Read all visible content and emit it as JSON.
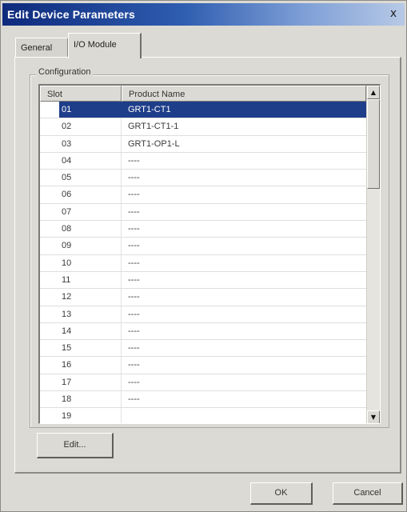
{
  "dialog": {
    "title": "Edit Device Parameters",
    "close_label": "x"
  },
  "tabs": [
    {
      "label": "General",
      "active": false
    },
    {
      "label": "I/O Module",
      "active": true
    }
  ],
  "configuration": {
    "group_label": "Configuration",
    "columns": [
      "Slot",
      "Product Name"
    ],
    "rows": [
      {
        "slot": "01",
        "product": "GRT1-CT1",
        "selected": true
      },
      {
        "slot": "02",
        "product": "GRT1-CT1-1"
      },
      {
        "slot": "03",
        "product": "GRT1-OP1-L"
      },
      {
        "slot": "04",
        "product": "----"
      },
      {
        "slot": "05",
        "product": "----"
      },
      {
        "slot": "06",
        "product": "----"
      },
      {
        "slot": "07",
        "product": "----"
      },
      {
        "slot": "08",
        "product": "----"
      },
      {
        "slot": "09",
        "product": "----"
      },
      {
        "slot": "10",
        "product": "----"
      },
      {
        "slot": "11",
        "product": "----"
      },
      {
        "slot": "12",
        "product": "----"
      },
      {
        "slot": "13",
        "product": "----"
      },
      {
        "slot": "14",
        "product": "----"
      },
      {
        "slot": "15",
        "product": "----"
      },
      {
        "slot": "16",
        "product": "----"
      },
      {
        "slot": "17",
        "product": "----"
      },
      {
        "slot": "18",
        "product": "----"
      },
      {
        "slot": "19",
        "product": ""
      }
    ],
    "scroll_up_icon": "scroll-up-arrow",
    "scroll_down_icon": "scroll-down-arrow"
  },
  "buttons": {
    "edit_label": "Edit...",
    "ok_label": "OK",
    "cancel_label": "Cancel"
  },
  "colors": {
    "title_bar": "#0e2a7c",
    "selection": "#1f3e8a"
  }
}
